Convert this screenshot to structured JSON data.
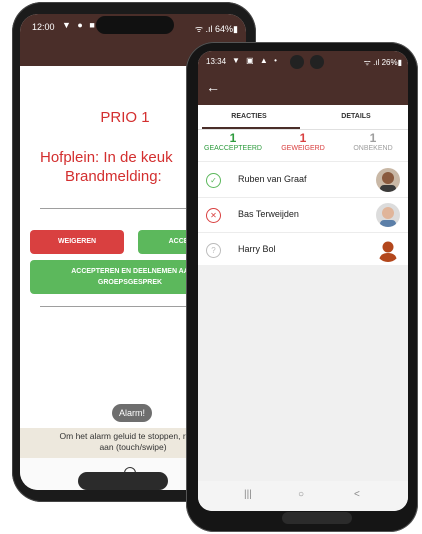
{
  "back_phone": {
    "status_time": "12:00",
    "status_icons": "▼ ● ■ •",
    "status_right": "ᯤ .ıl 64%▮",
    "prio_title": "PRIO 1",
    "location_text": "Hofplein: In de keuk",
    "event_text": "Brandmelding:",
    "buttons": {
      "reject": "WEIGEREN",
      "accept": "ACCEPT",
      "accept_join": "ACCEPTEREN EN DEELNEMEN AA",
      "accept_join_line2": "GROEPSGESPREK"
    },
    "toast": "Alarm!",
    "hint_line1": "Om het alarm geluid te stoppen, raak h",
    "hint_line2": "aan (touch/swipe)"
  },
  "front_phone": {
    "status_time": "13:34",
    "status_icons": "▼ ▣ ▲ •",
    "status_right": "ᯤ .ıl 26%▮",
    "back_icon": "arrow-left-icon",
    "tabs": [
      {
        "label": "REACTIES",
        "active": true
      },
      {
        "label": "DETAILS",
        "active": false
      }
    ],
    "counts": [
      {
        "number": "1",
        "label": "GEACCEPTEERD",
        "color": "#2e9b3e"
      },
      {
        "number": "1",
        "label": "GEWEIGERD",
        "color": "#d94040"
      },
      {
        "number": "1",
        "label": "ONBEKEND",
        "color": "#9e9e9e"
      }
    ],
    "reactions": [
      {
        "name": "Ruben van Graaf",
        "status": "accepted",
        "icon": "check-circle-icon"
      },
      {
        "name": "Bas Terweijden",
        "status": "rejected",
        "icon": "x-circle-icon"
      },
      {
        "name": "Harry Bol",
        "status": "unknown",
        "icon": "question-circle-icon"
      }
    ],
    "nav": {
      "recent": "|||",
      "home": "○",
      "back": "<"
    }
  },
  "colors": {
    "appbar": "#4a2e29",
    "accent_red": "#d32f2f",
    "accent_green": "#5cb85c"
  }
}
